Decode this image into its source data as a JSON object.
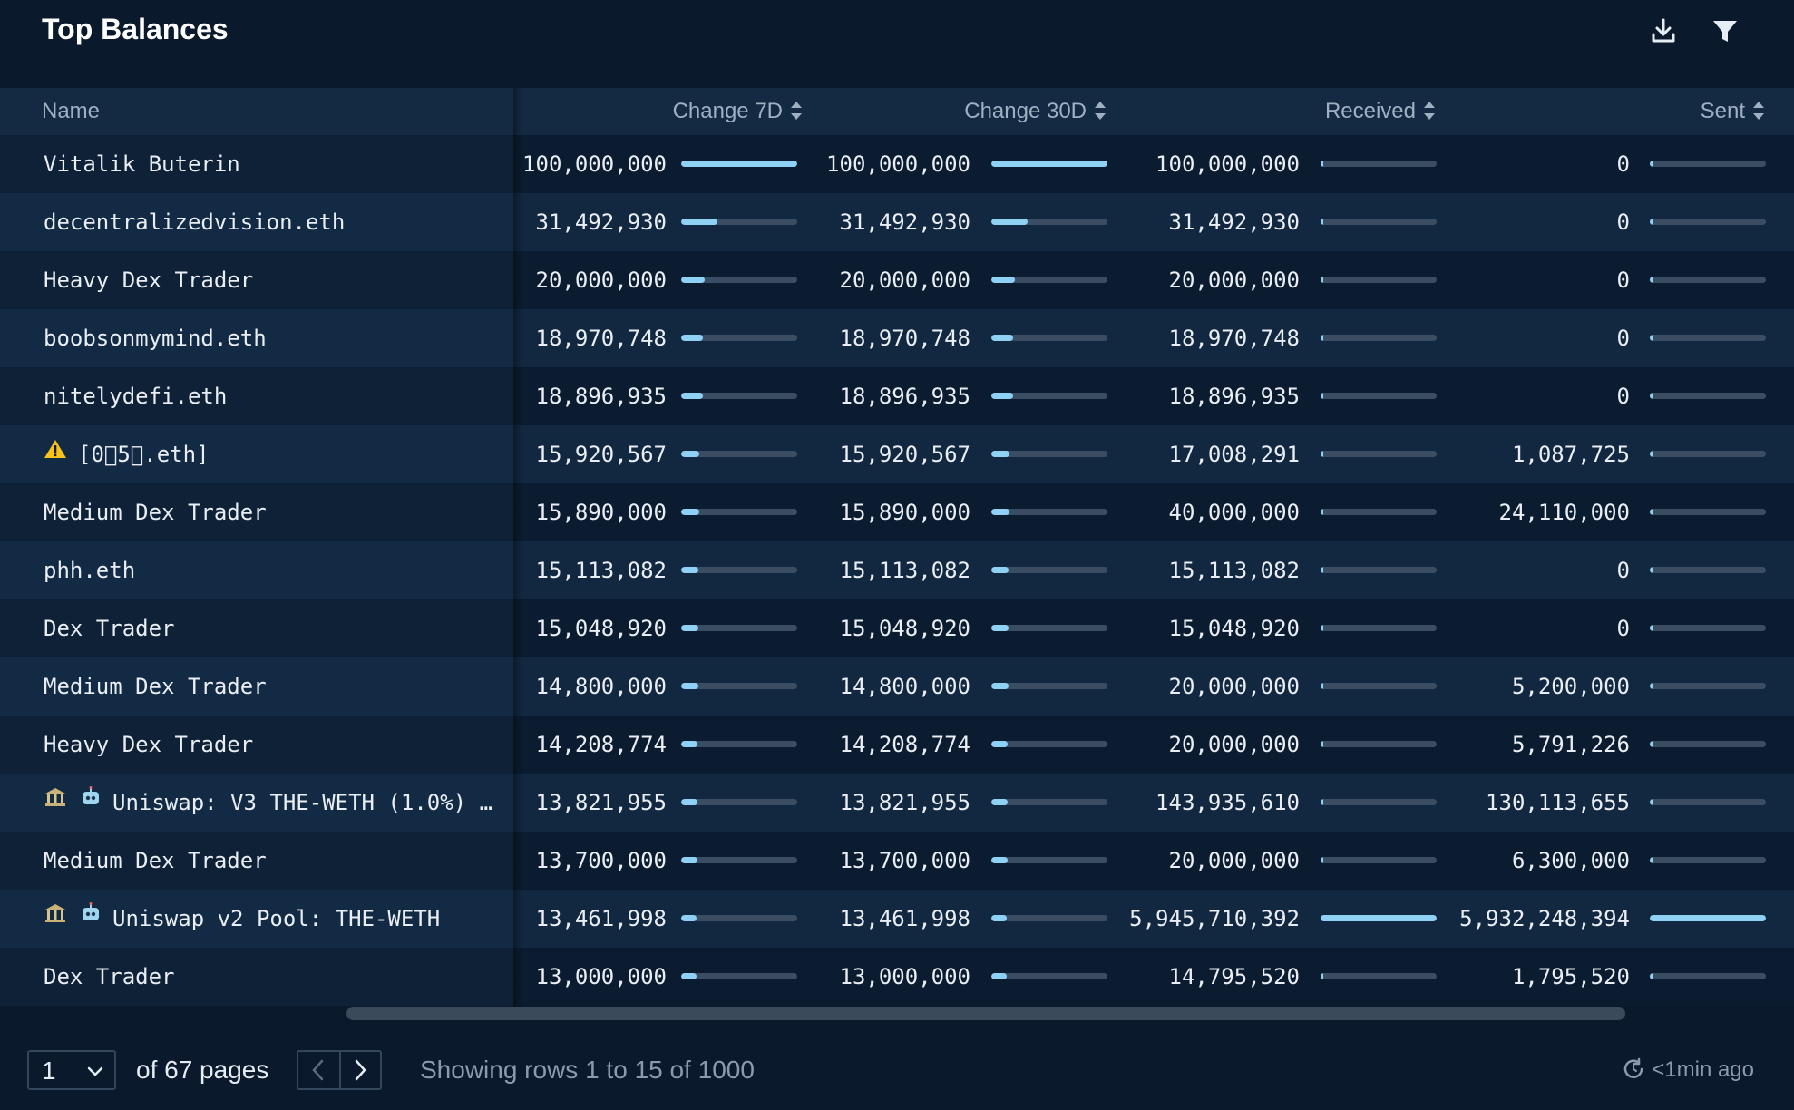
{
  "header": {
    "title": "Top Balances",
    "download_icon": "download-icon",
    "filter_icon": "filter-icon"
  },
  "columns": {
    "name": "Name",
    "change7d": "Change 7D",
    "change30d": "Change 30D",
    "received": "Received",
    "sent": "Sent"
  },
  "rows": [
    {
      "name": "Vitalik Buterin",
      "icon": "",
      "change7d": "100,000,000",
      "change30d": "100,000,000",
      "received": "100,000,000",
      "sent": "0",
      "b7": 1.0,
      "b30": 1.0,
      "br": 0.0,
      "bs": 0.0
    },
    {
      "name": "decentralizedvision.eth",
      "icon": "",
      "change7d": "31,492,930",
      "change30d": "31,492,930",
      "received": "31,492,930",
      "sent": "0",
      "b7": 0.31,
      "b30": 0.31,
      "br": 0.0,
      "bs": 0.0
    },
    {
      "name": "Heavy Dex Trader",
      "icon": "",
      "change7d": "20,000,000",
      "change30d": "20,000,000",
      "received": "20,000,000",
      "sent": "0",
      "b7": 0.2,
      "b30": 0.2,
      "br": 0.0,
      "bs": 0.0
    },
    {
      "name": "boobsonmymind.eth",
      "icon": "",
      "change7d": "18,970,748",
      "change30d": "18,970,748",
      "received": "18,970,748",
      "sent": "0",
      "b7": 0.19,
      "b30": 0.19,
      "br": 0.0,
      "bs": 0.0
    },
    {
      "name": "nitelydefi.eth",
      "icon": "",
      "change7d": "18,896,935",
      "change30d": "18,896,935",
      "received": "18,896,935",
      "sent": "0",
      "b7": 0.19,
      "b30": 0.19,
      "br": 0.0,
      "bs": 0.0
    },
    {
      "name": "[0􏰀5􏰀.eth]",
      "icon": "warning",
      "change7d": "15,920,567",
      "change30d": "15,920,567",
      "received": "17,008,291",
      "sent": "1,087,725",
      "b7": 0.16,
      "b30": 0.16,
      "br": 0.0,
      "bs": 0.0
    },
    {
      "name": "Medium Dex Trader",
      "icon": "",
      "change7d": "15,890,000",
      "change30d": "15,890,000",
      "received": "40,000,000",
      "sent": "24,110,000",
      "b7": 0.16,
      "b30": 0.16,
      "br": 0.0,
      "bs": 0.0
    },
    {
      "name": "phh.eth",
      "icon": "",
      "change7d": "15,113,082",
      "change30d": "15,113,082",
      "received": "15,113,082",
      "sent": "0",
      "b7": 0.15,
      "b30": 0.15,
      "br": 0.0,
      "bs": 0.0
    },
    {
      "name": "Dex Trader",
      "icon": "",
      "change7d": "15,048,920",
      "change30d": "15,048,920",
      "received": "15,048,920",
      "sent": "0",
      "b7": 0.15,
      "b30": 0.15,
      "br": 0.0,
      "bs": 0.0
    },
    {
      "name": "Medium Dex Trader",
      "icon": "",
      "change7d": "14,800,000",
      "change30d": "14,800,000",
      "received": "20,000,000",
      "sent": "5,200,000",
      "b7": 0.15,
      "b30": 0.15,
      "br": 0.0,
      "bs": 0.0
    },
    {
      "name": "Heavy Dex Trader",
      "icon": "",
      "change7d": "14,208,774",
      "change30d": "14,208,774",
      "received": "20,000,000",
      "sent": "5,791,226",
      "b7": 0.14,
      "b30": 0.14,
      "br": 0.0,
      "bs": 0.0
    },
    {
      "name": "Uniswap: V3 THE-WETH (1.0%) …",
      "icon": "exchange-robot",
      "change7d": "13,821,955",
      "change30d": "13,821,955",
      "received": "143,935,610",
      "sent": "130,113,655",
      "b7": 0.14,
      "b30": 0.14,
      "br": 0.02,
      "bs": 0.02
    },
    {
      "name": "Medium Dex Trader",
      "icon": "",
      "change7d": "13,700,000",
      "change30d": "13,700,000",
      "received": "20,000,000",
      "sent": "6,300,000",
      "b7": 0.14,
      "b30": 0.14,
      "br": 0.0,
      "bs": 0.0
    },
    {
      "name": "Uniswap v2 Pool: THE-WETH",
      "icon": "exchange-robot",
      "change7d": "13,461,998",
      "change30d": "13,461,998",
      "received": "5,945,710,392",
      "sent": "5,932,248,394",
      "b7": 0.13,
      "b30": 0.13,
      "br": 1.0,
      "bs": 1.0
    },
    {
      "name": "Dex Trader",
      "icon": "",
      "change7d": "13,000,000",
      "change30d": "13,000,000",
      "received": "14,795,520",
      "sent": "1,795,520",
      "b7": 0.13,
      "b30": 0.13,
      "br": 0.0,
      "bs": 0.0
    }
  ],
  "footer": {
    "page_value": "1",
    "of_pages": "of 67 pages",
    "showing": "Showing rows 1 to 15 of 1000",
    "updated": "<1min ago",
    "prev_icon": "chevron-left-icon",
    "next_icon": "chevron-right-icon",
    "refresh_icon": "refresh-icon"
  },
  "colors": {
    "background": "#0a1a2c",
    "header_row": "#142a42",
    "bar_fill": "#8fd0f5",
    "bar_track": "#3a4d63"
  }
}
